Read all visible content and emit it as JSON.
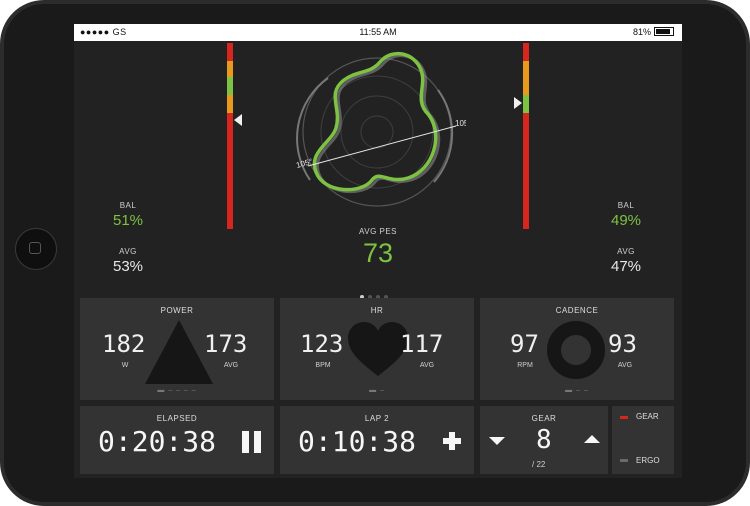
{
  "status": {
    "carrier": "●●●●● GS",
    "time": "11:55 AM",
    "battery": "81%"
  },
  "left": {
    "bal_label": "BAL",
    "bal_value": "51%",
    "avg_label": "AVG",
    "avg_value": "53%"
  },
  "right": {
    "bal_label": "BAL",
    "bal_value": "49%",
    "avg_label": "AVG",
    "avg_value": "47%"
  },
  "polar": {
    "angle_left": "105°",
    "angle_right": "105°"
  },
  "pes": {
    "label": "AVG PES",
    "value": "73"
  },
  "power": {
    "title": "POWER",
    "left_value": "182",
    "left_unit": "W",
    "right_value": "173",
    "right_unit": "AVG"
  },
  "hr": {
    "title": "HR",
    "left_value": "123",
    "left_unit": "BPM",
    "right_value": "117",
    "right_unit": "AVG"
  },
  "cadence": {
    "title": "CADENCE",
    "left_value": "97",
    "left_unit": "RPM",
    "right_value": "93",
    "right_unit": "AVG"
  },
  "elapsed": {
    "title": "ELAPSED",
    "value": "0:20:38"
  },
  "lap": {
    "title": "LAP 2",
    "value": "0:10:38"
  },
  "gear": {
    "title": "GEAR",
    "value": "8",
    "total": "/ 22"
  },
  "mode": {
    "gear_label": "GEAR",
    "ergo_label": "ERGO"
  },
  "colors": {
    "green": "#7dc242",
    "red": "#d7261e",
    "orange": "#e99a1c"
  },
  "icons": [
    "pause-icon",
    "plus-icon",
    "chevron-down-icon",
    "chevron-up-icon",
    "triangle-icon",
    "heart-icon",
    "ring-icon"
  ]
}
